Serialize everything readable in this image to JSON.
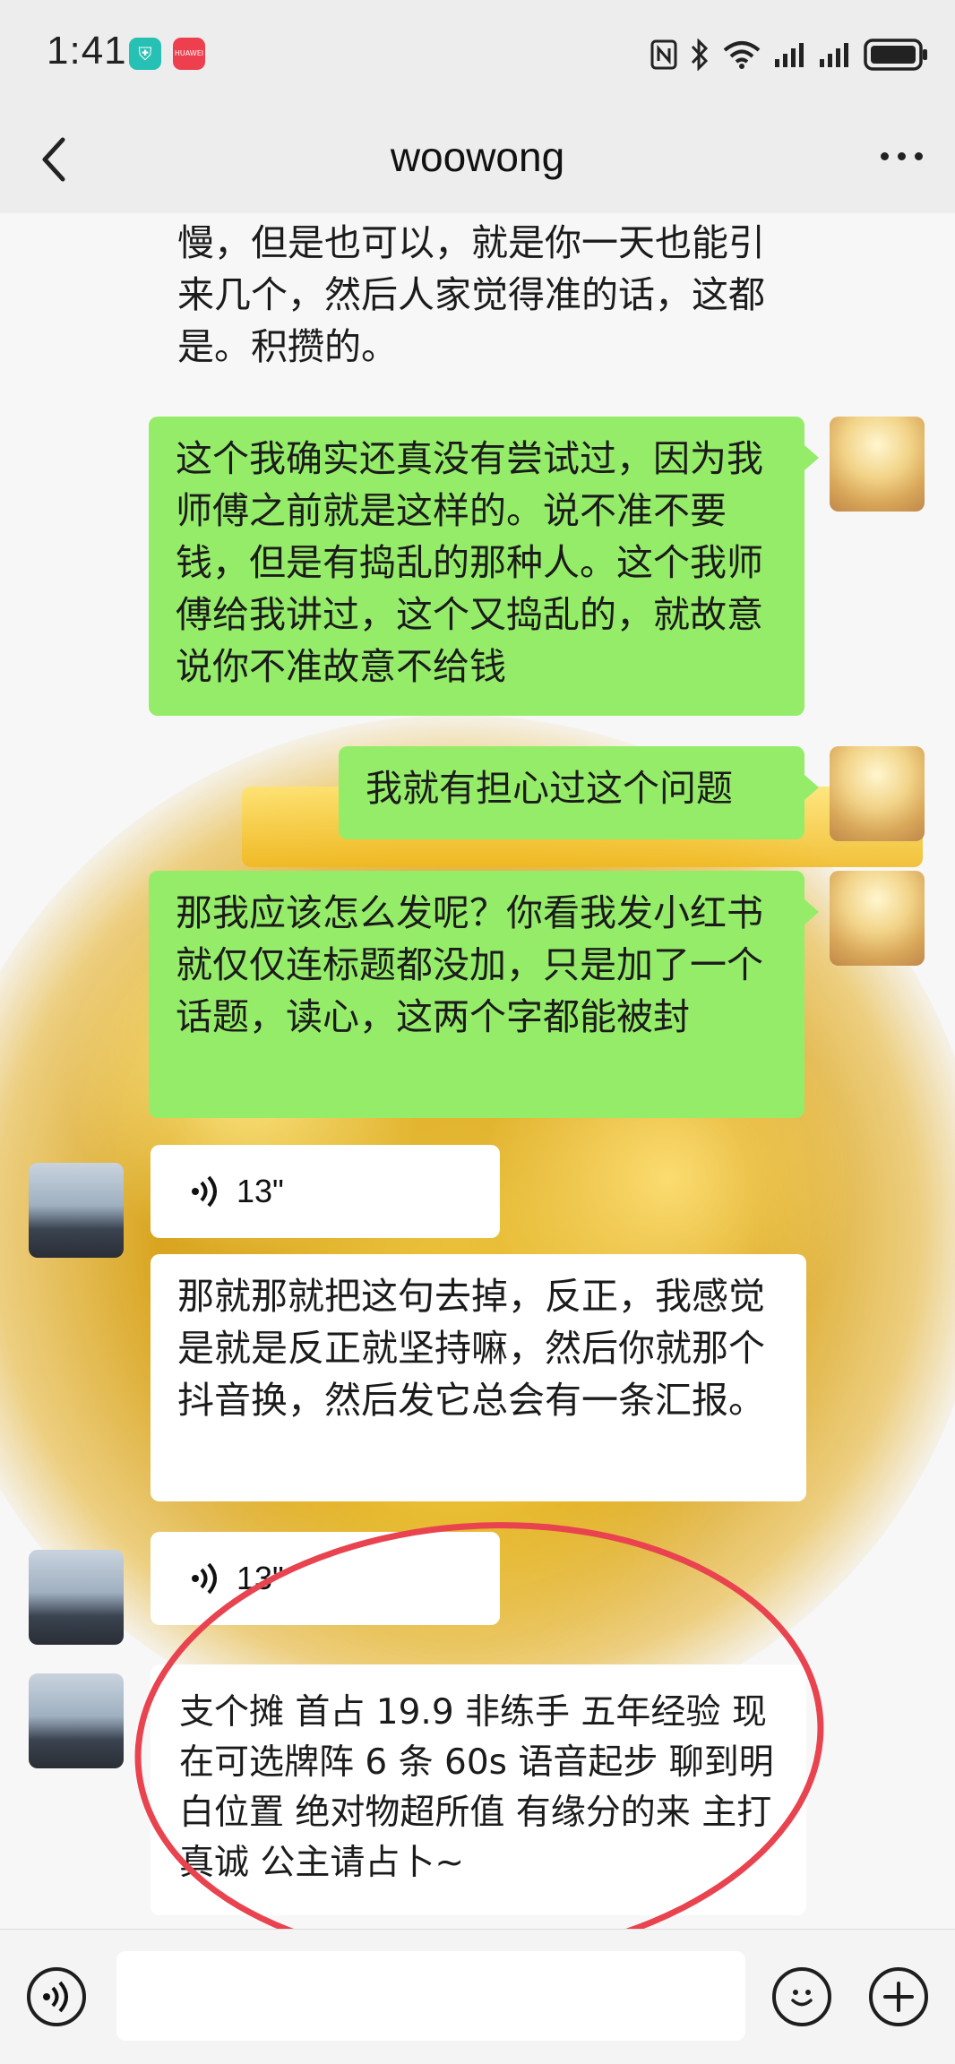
{
  "status_bar": {
    "time": "1:41",
    "badge_shield": "⛨",
    "badge_huawei": "HUAWEI",
    "icons": [
      "nfc-icon",
      "bluetooth-icon",
      "wifi-icon",
      "signal-icon",
      "signal-icon-2",
      "battery-icon"
    ]
  },
  "header": {
    "title": "woowong",
    "back_icon": "chevron-left-icon",
    "more_icon": "more-icon"
  },
  "messages": [
    {
      "side": "them",
      "type": "text",
      "text": "慢，但是也可以，就是你一天也能引来几个，然后人家觉得准的话，这都是。积攒的。"
    },
    {
      "side": "me",
      "type": "text",
      "text": "这个我确实还真没有尝试过，因为我师傅之前就是这样的。说不准不要钱，但是有捣乱的那种人。这个我师傅给我讲过，这个又捣乱的，就故意说你不准故意不给钱"
    },
    {
      "side": "me",
      "type": "text",
      "text": "我就有担心过这个问题"
    },
    {
      "side": "me",
      "type": "text",
      "text": "那我应该怎么发呢？你看我发小红书就仅仅连标题都没加，只是加了一个话题，读心，这两个字都能被封"
    },
    {
      "side": "them",
      "type": "voice",
      "duration": "13\""
    },
    {
      "side": "them",
      "type": "text",
      "text": "那就那就把这句去掉，反正，我感觉是就是反正就坚持嘛，然后你就那个抖音换，然后发它总会有一条汇报。"
    },
    {
      "side": "them",
      "type": "voice",
      "duration": "13\""
    },
    {
      "side": "them",
      "type": "text",
      "text": "支个摊 首占 19.9 非练手 五年经验 现在可选牌阵 6 条 60s 语音起步 聊到明白位置 绝对物超所值 有缘分的来 主打真诚 公主请占卜~"
    }
  ],
  "input_bar": {
    "voice_button_icon": "voice-mode-icon",
    "text_placeholder": "",
    "emoji_icon": "emoji-icon",
    "plus_icon": "plus-icon"
  },
  "colors": {
    "me_bubble": "#95ec69",
    "them_bubble": "#ffffff",
    "annotation_circle": "#e8434f"
  }
}
